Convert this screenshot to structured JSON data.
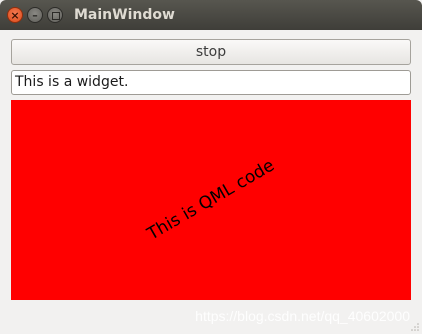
{
  "window": {
    "title": "MainWindow",
    "controls": {
      "close_icon": "close-icon",
      "minimize_icon": "minimize-icon",
      "maximize_icon": "maximize-icon"
    }
  },
  "toolbar": {
    "stop_label": "stop"
  },
  "line_edit": {
    "value": "This is a widget."
  },
  "qml": {
    "text": "This is QML code",
    "background_color": "#ff0000"
  },
  "watermark": {
    "text": "https://blog.csdn.net/qq_40602000"
  }
}
